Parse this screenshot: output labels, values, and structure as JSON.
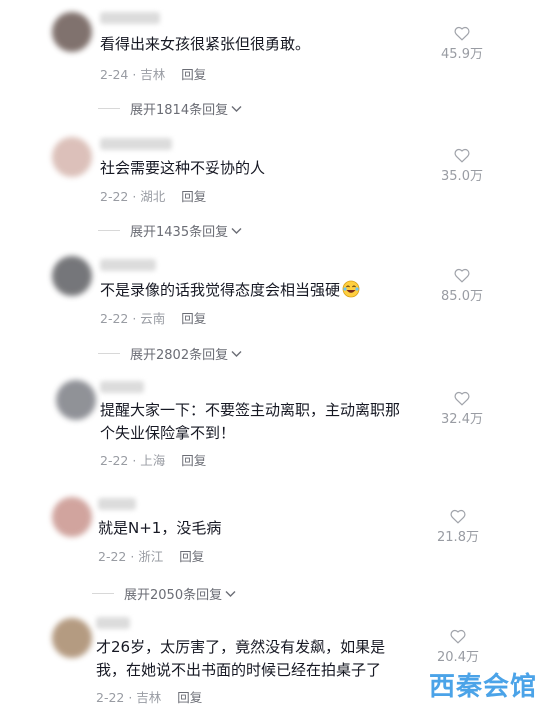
{
  "comments": [
    {
      "text": "看得出来女孩很紧张但很勇敢。",
      "date_location": "2-24 · 吉林",
      "reply_label": "回复",
      "likes": "45.9万",
      "expand_label": "展开1814条回复",
      "avatar_color": "#6b5a55"
    },
    {
      "text": "社会需要这种不妥协的人",
      "date_location": "2-22 · 湖北",
      "reply_label": "回复",
      "likes": "35.0万",
      "expand_label": "展开1435条回复",
      "avatar_color": "#d6b6ae"
    },
    {
      "text": "不是录像的话我觉得态度会相当强硬",
      "date_location": "2-22 · 云南",
      "reply_label": "回复",
      "likes": "85.0万",
      "expand_label": "展开2802条回复",
      "avatar_color": "#5e5f63",
      "emoji": "laughing-emoji"
    },
    {
      "text_line1": "提醒大家一下：不要签主动离职，主动离职那",
      "text_line2": "个失业保险拿不到！",
      "date_location": "2-22 · 上海",
      "reply_label": "回复",
      "likes": "32.4万",
      "avatar_color": "#7d7f86"
    },
    {
      "text": "就是N+1，没毛病",
      "date_location": "2-22 · 浙江",
      "reply_label": "回复",
      "likes": "21.8万",
      "expand_label": "展开2050条回复",
      "avatar_color": "#c9958e"
    },
    {
      "text_line1": "才26岁，太厉害了，竟然没有发飙，如果是",
      "text_line2": "我，在她说不出书面的时候已经在拍桌子了",
      "date_location": "2-22 · 吉林",
      "reply_label": "回复",
      "likes": "20.4万",
      "avatar_color": "#a88a6c"
    }
  ],
  "watermark": "西秦会馆",
  "colors": {
    "text": "#161823",
    "meta": "#999ca3",
    "watermark": "#4ba3e8"
  }
}
